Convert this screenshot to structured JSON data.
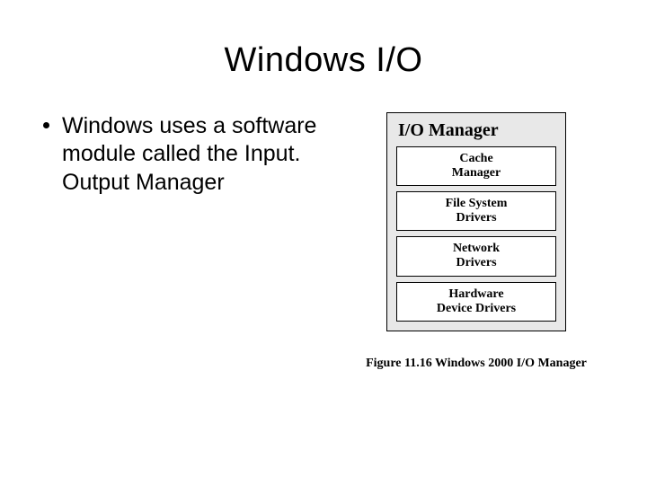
{
  "title": "Windows I/O",
  "bullet": "Windows uses a software module called the Input. Output Manager",
  "figure": {
    "heading": "I/O Manager",
    "boxes": [
      "Cache\nManager",
      "File System\nDrivers",
      "Network\nDrivers",
      "Hardware\nDevice Drivers"
    ],
    "caption": "Figure 11.16   Windows 2000 I/O Manager"
  }
}
